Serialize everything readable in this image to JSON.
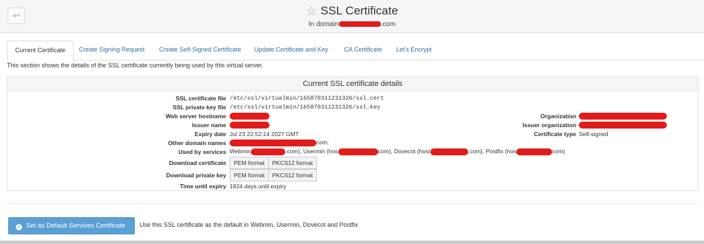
{
  "header": {
    "back_icon": "back-arrow-icon",
    "star_icon": "star-outline-icon",
    "title": "SSL Certificate",
    "subtitle_prefix": "In domain",
    "subtitle_suffix": ".com"
  },
  "tabs": [
    {
      "label": "Current Certificate"
    },
    {
      "label": "Create Signing Request"
    },
    {
      "label": "Create Self-Signed Certificate"
    },
    {
      "label": "Update Certificate and Key"
    },
    {
      "label": "CA Certificate"
    },
    {
      "label": "Let's Encrypt"
    }
  ],
  "intro": "This section shows the details of the SSL certificate currently being used by this virtual server.",
  "panel": {
    "title": "Current SSL certificate details",
    "labels": {
      "cert_file": "SSL certificate file",
      "key_file": "SSL private key file",
      "web_hostname": "Web server hostname",
      "issuer": "Issuer name",
      "expiry": "Expiry date",
      "other_domains": "Other domain names",
      "used_by": "Used by services",
      "dl_cert": "Download certificate",
      "dl_key": "Download private key",
      "time_expiry": "Time until expiry",
      "organization": "Organization",
      "issuer_org": "Issuer organization",
      "cert_type": "Certificate type"
    },
    "values": {
      "cert_file": "/etc/ssl/virtualmin/165870311231326/ssl.cert",
      "key_file": "/etc/ssl/virtualmin/165870311231326/ssl.key",
      "expiry": "Jul 23 22:52:14 2027 GMT",
      "other_domains_suffix": "com.",
      "used_by": {
        "webmin": "Webmin",
        "webmin_end": ".com), Usermin (hos",
        "usermin_end": "com), Dovecot (host",
        "dovecot_end": ".com), Postfix (hos",
        "postfix_end": "com)"
      },
      "pem": "PEM format",
      "pkcs12": "PKCS12 format",
      "time_expiry": "1824 days until expiry",
      "cert_type": "Self-signed"
    }
  },
  "footer": {
    "default_button": "Set as Default Services Certificate",
    "default_icon": "check-circle-icon",
    "default_desc": "Use this SSL certificate as the default in Webmin, Usermin, Dovecot and Postfix"
  },
  "colors": {
    "accent": "#5ba0d4",
    "link": "#2f6ea8",
    "redaction": "#e21b1b"
  }
}
